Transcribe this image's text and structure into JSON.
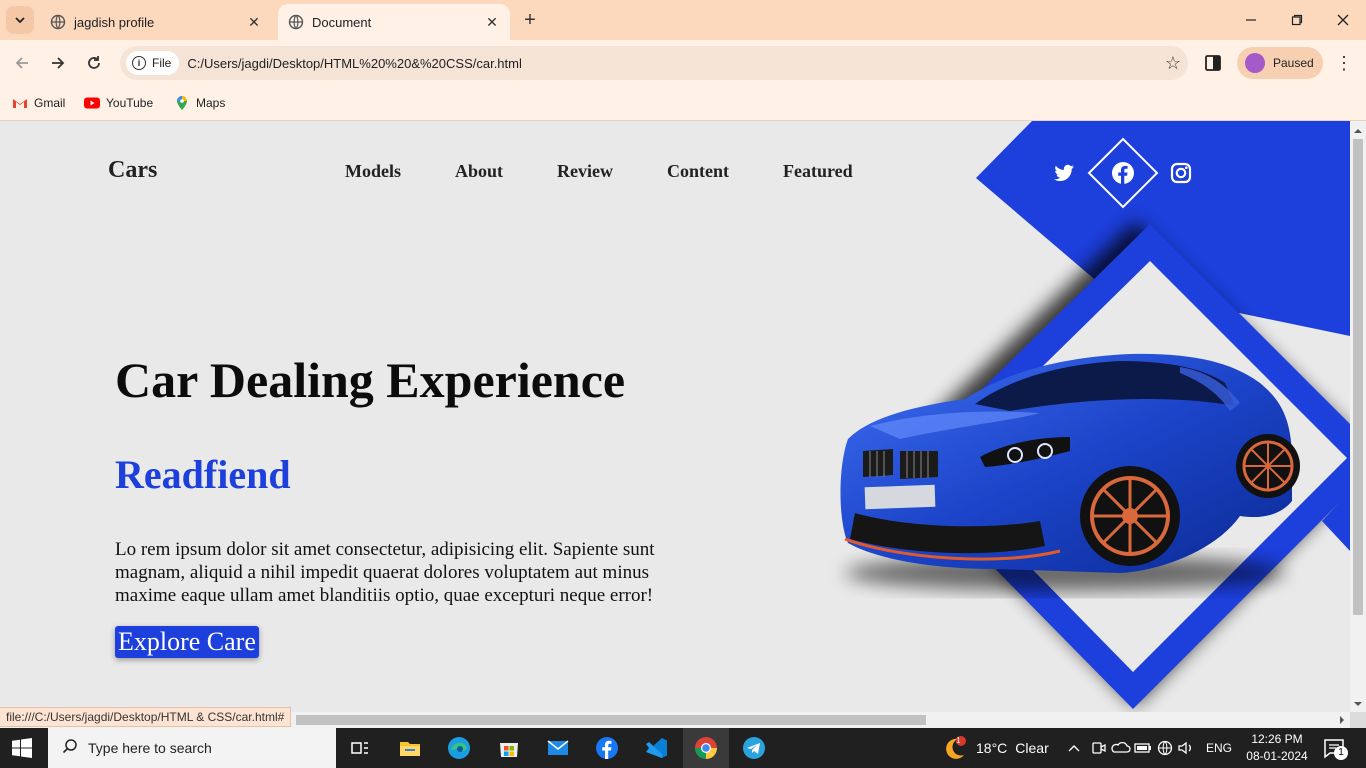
{
  "browser": {
    "tabs": [
      {
        "title": "jagdish profile",
        "active": false
      },
      {
        "title": "Document",
        "active": true
      }
    ],
    "omnibox": {
      "scheme_chip": "File",
      "url": "C:/Users/jagdi/Desktop/HTML%20%20&%20CSS/car.html"
    },
    "profile": {
      "label": "Paused"
    },
    "bookmarks": [
      {
        "label": "Gmail",
        "icon": "gmail-icon"
      },
      {
        "label": "YouTube",
        "icon": "youtube-icon"
      },
      {
        "label": "Maps",
        "icon": "maps-icon"
      }
    ],
    "status_url": "file:///C:/Users/jagdi/Desktop/HTML  & CSS/car.html#"
  },
  "page": {
    "logo": "Cars",
    "nav": [
      "Models",
      "About",
      "Review",
      "Content",
      "Featured"
    ],
    "hero": {
      "title": "Car Dealing Experience",
      "subtitle": "Readfiend",
      "text": "Lo rem ipsum dolor sit amet consectetur, adipisicing elit. Sapiente sunt magnam, aliquid a nihil impedit quaerat dolores voluptatem aut minus maxime eaque ullam amet blanditiis optio, quae excepturi neque error!",
      "button": "Explore Care"
    },
    "social": [
      "twitter-icon",
      "facebook-icon",
      "instagram-icon"
    ],
    "colors": {
      "accent": "#1d3fdc",
      "background": "#e9e9e9",
      "car": "#1a3fbf"
    }
  },
  "taskbar": {
    "search_placeholder": "Type here to search",
    "weather": {
      "temp": "18°C",
      "condition": "Clear",
      "badge": "1"
    },
    "language": "ENG",
    "time": "12:26 PM",
    "date": "08-01-2024",
    "notification_count": "1"
  }
}
